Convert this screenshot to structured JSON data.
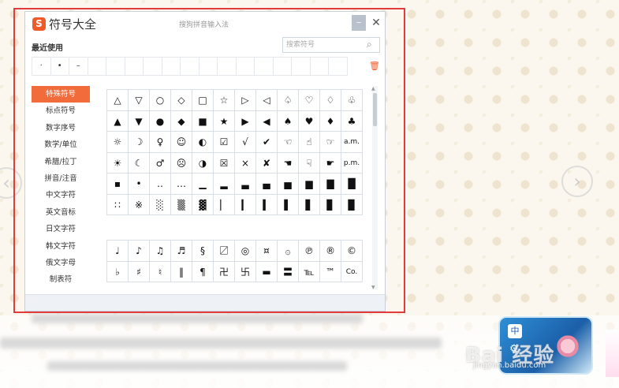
{
  "window": {
    "logo": "S",
    "title": "符号大全",
    "subtitle": "搜狗拼音输入法",
    "minimize": "–",
    "close": "✕"
  },
  "recent": {
    "label": "最近使用",
    "items": [
      "·",
      "•",
      "–",
      "",
      "",
      "",
      "",
      "",
      "",
      "",
      "",
      "",
      "",
      "",
      "",
      "",
      ""
    ]
  },
  "search": {
    "placeholder": "搜索符号"
  },
  "categories": [
    "特殊符号",
    "标点符号",
    "数字序号",
    "数学/单位",
    "希腊/拉丁",
    "拼音/注音",
    "中文字符",
    "英文音标",
    "日文字符",
    "韩文字符",
    "俄文字母",
    "制表符"
  ],
  "active_category": "特殊符号",
  "symbols_grid_1": [
    "△",
    "▽",
    "○",
    "◇",
    "□",
    "☆",
    "▷",
    "◁",
    "♤",
    "♡",
    "♢",
    "♧",
    "▲",
    "▼",
    "●",
    "◆",
    "■",
    "★",
    "▶",
    "◀",
    "♠",
    "♥",
    "♦",
    "♣",
    "☼",
    "☽",
    "♀",
    "☺",
    "◐",
    "☑",
    "√",
    "✔",
    "☜",
    "☝",
    "☞",
    "a.m.",
    "☀",
    "☾",
    "♂",
    "☹",
    "◑",
    "☒",
    "×",
    "✘",
    "☚",
    "☟",
    "☛",
    "p.m.",
    "▪",
    "•",
    "‥",
    "…",
    "▁",
    "▂",
    "▃",
    "▄",
    "▅",
    "▆",
    "▇",
    "█",
    "∷",
    "※",
    "░",
    "▒",
    "▓",
    "▏",
    "▎",
    "▍",
    "▌",
    "▋",
    "▊",
    "▉"
  ],
  "symbols_grid_2": [
    "♩",
    "♪",
    "♫",
    "♬",
    "§",
    "〼",
    "◎",
    "¤",
    "۞",
    "℗",
    "®",
    "©",
    "♭",
    "♯",
    "♮",
    "‖",
    "¶",
    "卍",
    "卐",
    "▬",
    "〓",
    "℡",
    "™",
    "Co."
  ],
  "watermark": {
    "brand": "Bai 经验",
    "url": "jingyan.baidu.com"
  },
  "widget": {
    "cn": "中"
  }
}
